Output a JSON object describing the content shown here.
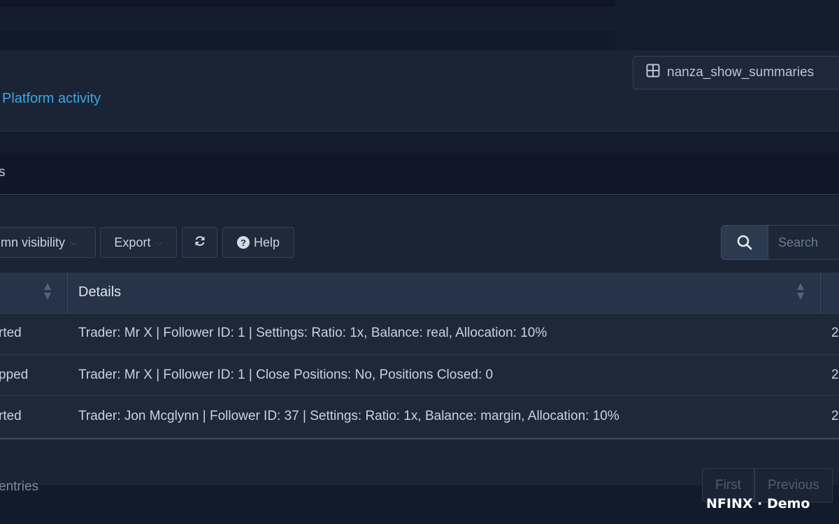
{
  "header": {
    "breadcrumb": "Platform activity",
    "summary_button": "nanza_show_summaries"
  },
  "section": {
    "title_fragment": "s"
  },
  "toolbar": {
    "column_visibility": "mn visibility",
    "export": "Export",
    "help": "Help"
  },
  "search": {
    "placeholder": "Search"
  },
  "table": {
    "columns": [
      "Details"
    ],
    "rows": [
      {
        "status": "rted",
        "details": "Trader: Mr X | Follower ID: 1 | Settings: Ratio: 1x, Balance: real, Allocation: 10%",
        "next": "2"
      },
      {
        "status": "pped",
        "details": "Trader: Mr X | Follower ID: 1 | Close Positions: No, Positions Closed: 0",
        "next": "2"
      },
      {
        "status": "rted",
        "details": "Trader: Jon Mcglynn | Follower ID: 37 | Settings: Ratio: 1x, Balance: margin, Allocation: 10%",
        "next": "2"
      }
    ]
  },
  "footer": {
    "entries": "entries",
    "pagination": {
      "first": "First",
      "previous": "Previous"
    }
  },
  "watermark": "NFINX · Demo",
  "colors": {
    "accent": "#3ea7e6",
    "background": "#121b2b",
    "card": "#1a2435",
    "header_row": "#263349"
  }
}
